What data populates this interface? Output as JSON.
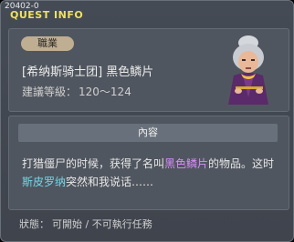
{
  "header": {
    "id": "20402-0",
    "title": "QUEST INFO"
  },
  "info": {
    "job_badge": "職業",
    "quest_name": "[希纳斯骑士团] 黑色鳞片",
    "level_label": "建議等級：",
    "level_value": "120～124",
    "npc": "elderly-woman-npc"
  },
  "content": {
    "header": "內容",
    "text_1": "打猎僵尸的时候，获得了名叫",
    "highlight_item": "黑色鳞片",
    "text_2": "的物品。这时",
    "highlight_npc": "斯皮罗纳",
    "text_3": "突然和我说话……"
  },
  "status": {
    "label": "狀態：",
    "value": "可開始 / 不可執行任務"
  },
  "colors": {
    "title": "#f0e060",
    "item_highlight": "#d98cff",
    "npc_highlight": "#6fd8e8"
  }
}
